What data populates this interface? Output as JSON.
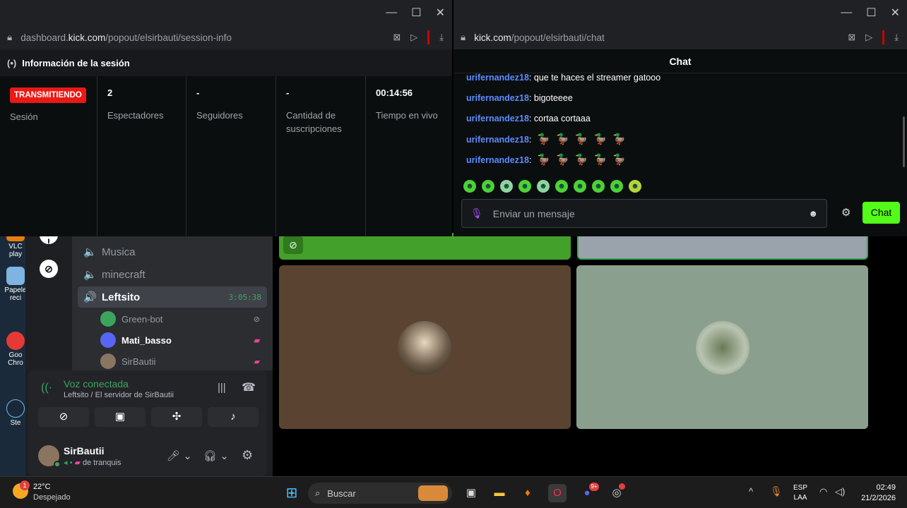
{
  "desktop": {
    "icons": [
      {
        "label": "VLC play",
        "color": "#e87d0d"
      },
      {
        "label": "Papele reci",
        "color": "#7fb3e0"
      },
      {
        "label": "Goo Chro",
        "color": "#e53935"
      },
      {
        "label": "Ste",
        "color": "#1b2838"
      }
    ]
  },
  "left_window": {
    "url_prefix": "dashboard.",
    "url_domain": "kick.com",
    "url_path": "/popout/elsirbauti/session-info",
    "section_title": "Información de la sesión",
    "columns": [
      {
        "value": "TRANSMITIENDO",
        "label": "Sesión"
      },
      {
        "value": "2",
        "label": "Espectadores"
      },
      {
        "value": "-",
        "label": "Seguidores"
      },
      {
        "value": "-",
        "label": "Cantidad de suscripciones"
      },
      {
        "value": "00:14:56",
        "label": "Tiempo en vivo"
      }
    ]
  },
  "right_window": {
    "url_domain": "kick.com",
    "url_path": "/popout/elsirbauti/chat",
    "chat_title": "Chat",
    "messages": [
      {
        "user": "urifernandez18",
        "text": "que te haces el streamer gatooo"
      },
      {
        "user": "urifernandez18",
        "text": "bigoteeee"
      },
      {
        "user": "urifernandez18",
        "text": "cortaa cortaaa"
      },
      {
        "user": "urifernandez18",
        "text": ""
      },
      {
        "user": "urifernandez18",
        "text": ""
      }
    ],
    "input_placeholder": "Enviar un mensaje",
    "send_label": "Chat"
  },
  "discord": {
    "channels": [
      {
        "name": "Musica"
      },
      {
        "name": "minecraft"
      },
      {
        "name": "Leftsito",
        "timer": "3:05:38"
      }
    ],
    "members": [
      {
        "name": "Green-bot",
        "color": "#3ba55d"
      },
      {
        "name": "Mati_basso",
        "color": "#5865f2"
      },
      {
        "name": "SirBautii",
        "color": "#8a7560"
      }
    ],
    "voice_status": "Voz conectada",
    "voice_location": "Leftsito / El servidor de SirBautii",
    "user_name": "SirBautii",
    "user_status": "de tranquis"
  },
  "taskbar": {
    "weather_temp": "22°C",
    "weather_desc": "Despejado",
    "weather_badge": "1",
    "search_placeholder": "Buscar",
    "lang_top": "ESP",
    "lang_bottom": "LAA",
    "time": "02:49",
    "date": "21/2/2026",
    "discord_badge": "9+"
  }
}
